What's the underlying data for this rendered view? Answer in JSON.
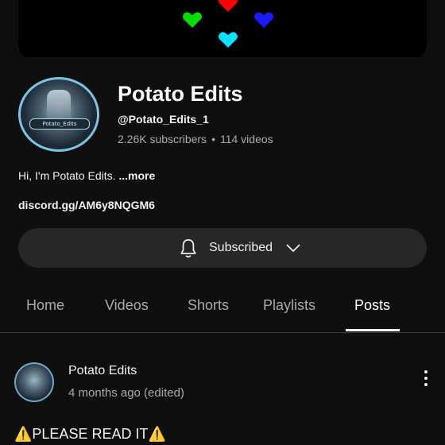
{
  "banner": {
    "hearts": [
      {
        "icon": "red-heart-icon",
        "color": "#ff0000"
      },
      {
        "icon": "green-heart-icon",
        "color": "#00e000"
      },
      {
        "icon": "blue-heart-icon",
        "color": "#1a1aff"
      },
      {
        "icon": "cyan-heart-icon",
        "color": "#00e5ff"
      }
    ]
  },
  "channel": {
    "name": "Potato Edits",
    "handle": "@Potato_Edits_1",
    "subscribers": "2.26K subscribers",
    "separator": "•",
    "videos": "114 videos",
    "description": "Hi, I'm Potato Edits. ",
    "more_label": "...more",
    "link": "discord.gg/AM6y8NQGM6",
    "avatar_badge_text": "Potato_Edits"
  },
  "subscribe_button": {
    "label": "Subscribed",
    "bell_icon": "bell-icon",
    "chevron_icon": "chevron-down-icon"
  },
  "tabs": [
    {
      "label": "Home",
      "active": false
    },
    {
      "label": "Videos",
      "active": false
    },
    {
      "label": "Shorts",
      "active": false
    },
    {
      "label": "Playlists",
      "active": false
    },
    {
      "label": "Posts",
      "active": true
    }
  ],
  "post": {
    "author": "Potato Edits",
    "time": "4 months ago (edited)",
    "text": "⚠️PLEASE READ IT⚠️",
    "menu_icon": "more-vertical-icon"
  },
  "colors": {
    "background": "#0f0f0f",
    "button_bg": "#272727",
    "secondary_text": "#aaaaaa"
  }
}
